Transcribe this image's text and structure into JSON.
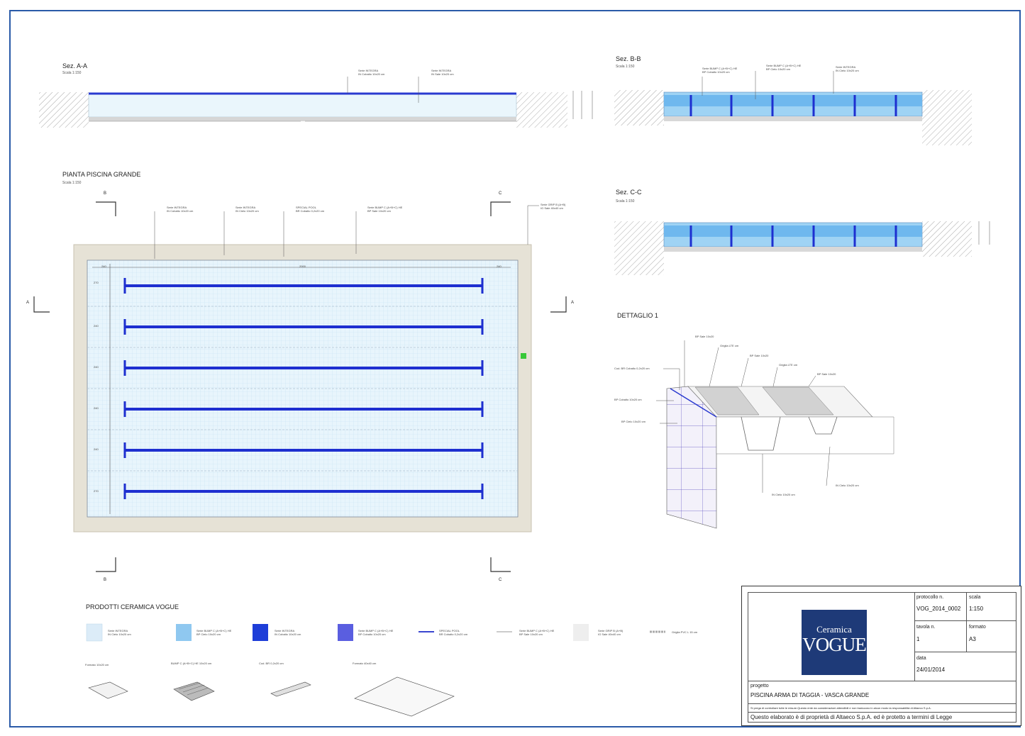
{
  "sections": {
    "aa": {
      "title": "Sez. A-A",
      "scale": "Scala 1:150",
      "labels": [
        "Serie INTEGRA\nIN Cobalto 10x20 cm",
        "Serie INTEGRA\nIN Sale 10x20 cm"
      ]
    },
    "bb": {
      "title": "Sez. B-B",
      "scale": "Scala 1:150",
      "labels": [
        "Serie BUMP C (A+B+C) HE\nBP Cobalto 10x20 cm",
        "Serie BUMP C (A+B+C) HE\nBP Cielo 10x20 cm",
        "Serie INTEGRA\nIN Cielo 10x20 cm"
      ]
    },
    "cc": {
      "title": "Sez. C-C",
      "scale": "Scala 1:150"
    }
  },
  "plan": {
    "title": "PIANTA PISCINA GRANDE",
    "scale": "Scala 1:150",
    "labels": [
      "Serie INTEGRA\nIN Cobalto 10x20 cm",
      "Serie INTEGRA\nIN Cielo 10x20 cm",
      "SPECIAL POOL\nBR Cobalto 0,2x20 cm",
      "Serie BUMP C (A+B+C) HE\nBP Sale 10x20 cm",
      "Serie GRIP B (A+B)\nIG Sale 40x40 cm"
    ],
    "dims": {
      "top_left": "240",
      "top_mid": "2000",
      "top_right": "240"
    },
    "lane_dims": [
      "270",
      "240",
      "240",
      "240",
      "240",
      "270"
    ],
    "markers": {
      "a": "A",
      "b": "B",
      "c": "C"
    }
  },
  "detail": {
    "title": "DETTAGLIO 1",
    "labels": [
      "BP Sale 10x20",
      "Griglia LTE cm",
      "BP Sale 10x20",
      "Griglia LTE cm",
      "BP Sale 10x20",
      "Cod. BR Cobalto 0,2x20 cm",
      "BP Cobalto 10x20 cm",
      "BP Cielo 10x20 cm",
      "IN Cielo 10x20 cm",
      "IN Cielo 10x20 cm"
    ]
  },
  "products": {
    "title": "PRODOTTI CERAMICA VOGUE",
    "items": [
      {
        "label": "Serie INTEGRA\nIN Cielo 10x20 cm",
        "color": "#dcecf8"
      },
      {
        "label": "Serie BUMP C (A+B+C) HE\nBP Cielo 10x20 cm",
        "color": "#8fc8f0"
      },
      {
        "label": "Serie INTEGRA\nIN Cobalto 10x20 cm",
        "color": "#1e3ed8"
      },
      {
        "label": "Serie BUMP C (A+B+C) HE\nBP Cobalto 10x20 cm",
        "color": "#5a5ee0"
      },
      {
        "label": "SPECIAL POOL\nBR Cobalto 0,2x20 cm",
        "color": "#3a46d0"
      },
      {
        "label": "Serie BUMP C (A+B+C) HE\nBP Sale 10x20 cm",
        "color": "#d8d8d8"
      },
      {
        "label": "Serie GRIP B (A+B)\nIG Sale 40x40 cm",
        "color": "#eeeeee"
      },
      {
        "label": "Griglia PVC L 15 cm",
        "color": "#cccccc"
      }
    ],
    "formats": [
      "Formato 10x20 cm",
      "BUMP C (A+B+C) HE 10x20 cm",
      "Cod. BR 0,2x20 cm",
      "Formato 40x40 cm"
    ]
  },
  "titleblock": {
    "logo_line1": "Ceramica",
    "logo_line2": "VOGUE",
    "protocollo_label": "protocollo n.",
    "protocollo": "VOG_2014_0002",
    "scala_label": "scala",
    "scala": "1:150",
    "tavola_label": "tavola n.",
    "tavola": "1",
    "formato_label": "formato",
    "formato": "A3",
    "data_label": "data",
    "data": "24/01/2014",
    "progetto_label": "progetto",
    "progetto": "PISCINA ARMA DI TAGGIA - VASCA GRANDE",
    "disclaimer": "Si prega di controllare tutte le misure.Questo ente da considerazioni attendibili e non traducono in alcun modo la responsabilità di Altaeco S.p.A.",
    "copyright": "Questo elaborato è di proprietà di Altaeco S.p.A. ed è protetto a termini di Legge"
  },
  "colors": {
    "cobalt": "#1e2fd0",
    "cielo": "#8fc8f0",
    "water": "#e6f4fb",
    "deck": "#e6e2d6",
    "hatch": "#999999",
    "frame": "#2a5aa8"
  }
}
